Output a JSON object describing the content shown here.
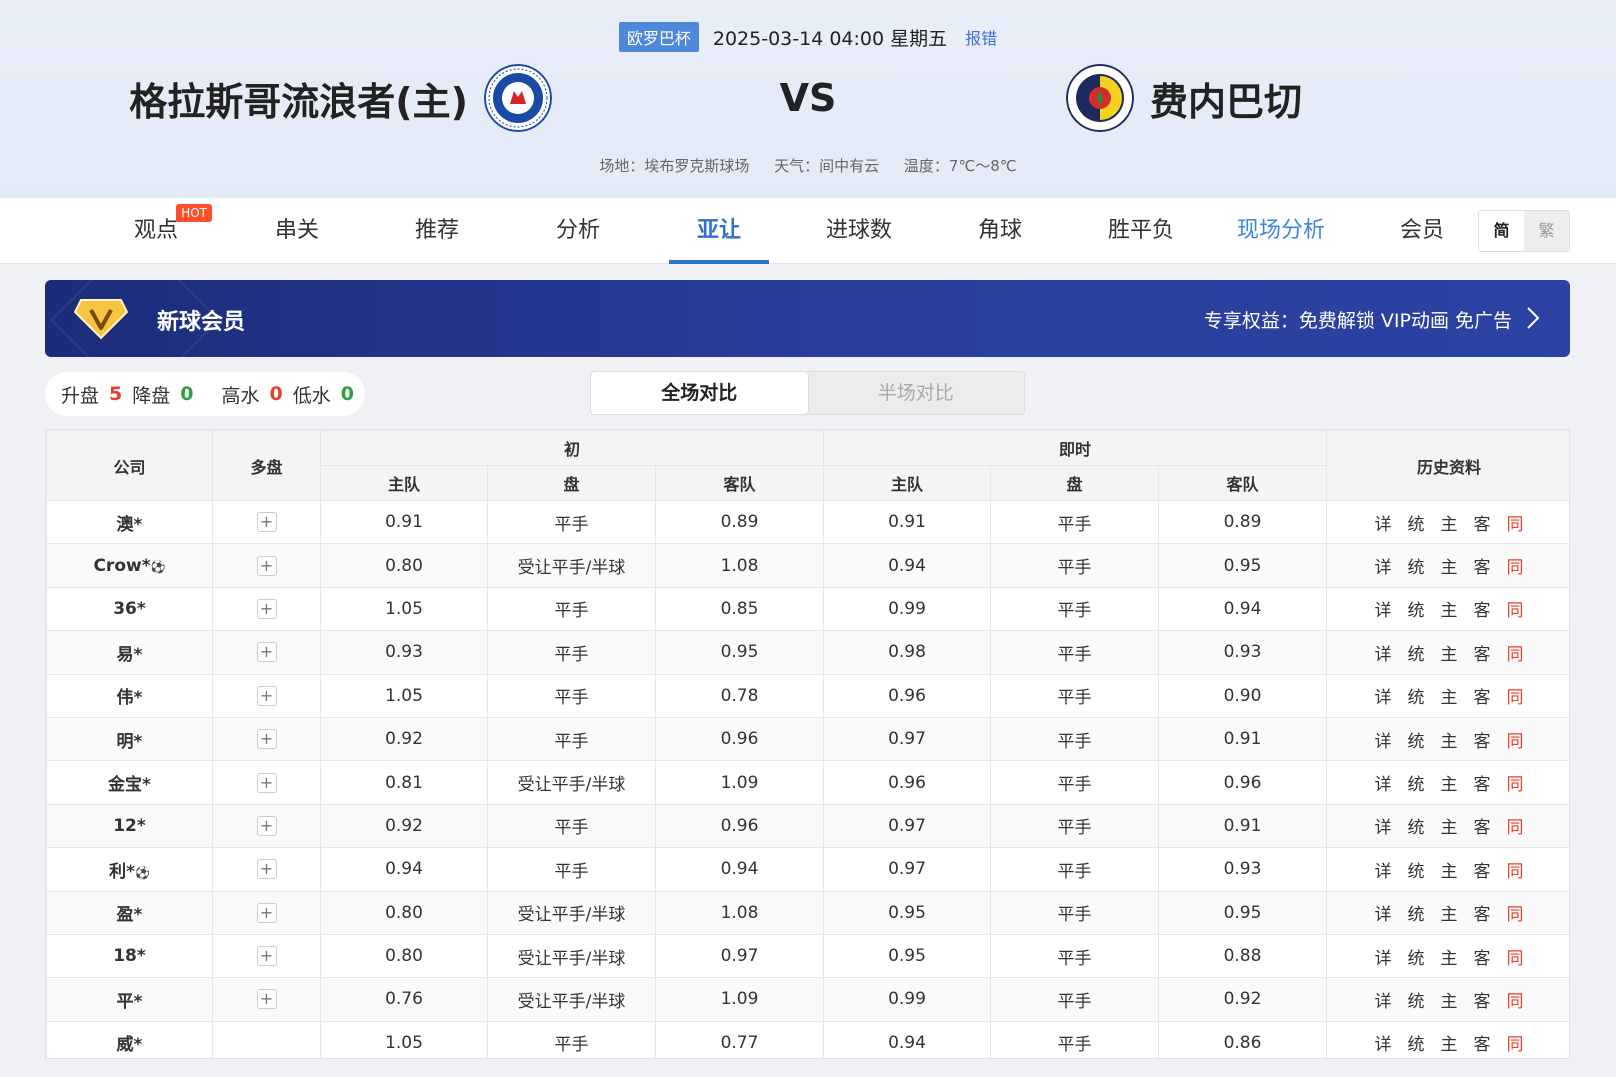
{
  "header": {
    "league": "欧罗巴杯",
    "datetime": "2025-03-14 04:00 星期五",
    "report": "报错",
    "home_team": "格拉斯哥流浪者(主)",
    "vs": "VS",
    "away_team": "费内巴切",
    "venue": "场地：埃布罗克斯球场",
    "weather": "天气：间中有云",
    "temperature": "温度：7℃～8℃"
  },
  "tabs": [
    {
      "label": "观点",
      "badge": "HOT"
    },
    {
      "label": "串关"
    },
    {
      "label": "推荐"
    },
    {
      "label": "分析"
    },
    {
      "label": "亚让"
    },
    {
      "label": "进球数"
    },
    {
      "label": "角球"
    },
    {
      "label": "胜平负"
    },
    {
      "label": "现场分析"
    },
    {
      "label": "会员"
    }
  ],
  "lang": {
    "simp": "简",
    "trad": "繁"
  },
  "vip": {
    "title": "新球会员",
    "benefit": "专享权益：免费解锁 VIP动画 免广告"
  },
  "stats": {
    "up_label": "升盘",
    "up_value": "5",
    "down_label": "降盘",
    "down_value": "0",
    "high_label": "高水",
    "high_value": "0",
    "low_label": "低水",
    "low_value": "0"
  },
  "segment": {
    "full": "全场对比",
    "half": "半场对比"
  },
  "table": {
    "headers": {
      "company": "公司",
      "multi": "多盘",
      "initial": "初",
      "live": "即时",
      "history": "历史资料",
      "home": "主队",
      "handicap": "盘",
      "away": "客队"
    },
    "history_links": {
      "detail": "详",
      "stats": "统",
      "home": "主",
      "away": "客",
      "same": "同"
    },
    "rows": [
      {
        "company": "澳*",
        "ball": "",
        "multi": true,
        "i_home": "0.91",
        "i_hcp": "平手",
        "i_away": "0.89",
        "l_home": "0.91",
        "l_hcp": "平手",
        "l_away": "0.89"
      },
      {
        "company": "Crow*",
        "ball": "⚽",
        "multi": true,
        "i_home": "0.80",
        "i_hcp": "受让平手/半球",
        "i_away": "1.08",
        "l_home": "0.94",
        "l_hcp": "平手",
        "l_away": "0.95"
      },
      {
        "company": "36*",
        "ball": "",
        "multi": true,
        "i_home": "1.05",
        "i_hcp": "平手",
        "i_away": "0.85",
        "l_home": "0.99",
        "l_hcp": "平手",
        "l_away": "0.94"
      },
      {
        "company": "易*",
        "ball": "",
        "multi": true,
        "i_home": "0.93",
        "i_hcp": "平手",
        "i_away": "0.95",
        "l_home": "0.98",
        "l_hcp": "平手",
        "l_away": "0.93"
      },
      {
        "company": "伟*",
        "ball": "",
        "multi": true,
        "i_home": "1.05",
        "i_hcp": "平手",
        "i_away": "0.78",
        "l_home": "0.96",
        "l_hcp": "平手",
        "l_away": "0.90"
      },
      {
        "company": "明*",
        "ball": "",
        "multi": true,
        "i_home": "0.92",
        "i_hcp": "平手",
        "i_away": "0.96",
        "l_home": "0.97",
        "l_hcp": "平手",
        "l_away": "0.91"
      },
      {
        "company": "金宝*",
        "ball": "",
        "multi": true,
        "i_home": "0.81",
        "i_hcp": "受让平手/半球",
        "i_away": "1.09",
        "l_home": "0.96",
        "l_hcp": "平手",
        "l_away": "0.96"
      },
      {
        "company": "12*",
        "ball": "",
        "multi": true,
        "i_home": "0.92",
        "i_hcp": "平手",
        "i_away": "0.96",
        "l_home": "0.97",
        "l_hcp": "平手",
        "l_away": "0.91"
      },
      {
        "company": "利*",
        "ball": "⚽",
        "multi": true,
        "i_home": "0.94",
        "i_hcp": "平手",
        "i_away": "0.94",
        "l_home": "0.97",
        "l_hcp": "平手",
        "l_away": "0.93"
      },
      {
        "company": "盈*",
        "ball": "",
        "multi": true,
        "i_home": "0.80",
        "i_hcp": "受让平手/半球",
        "i_away": "1.08",
        "l_home": "0.95",
        "l_hcp": "平手",
        "l_away": "0.95"
      },
      {
        "company": "18*",
        "ball": "",
        "multi": true,
        "i_home": "0.80",
        "i_hcp": "受让平手/半球",
        "i_away": "0.97",
        "l_home": "0.95",
        "l_hcp": "平手",
        "l_away": "0.88"
      },
      {
        "company": "平*",
        "ball": "",
        "multi": true,
        "i_home": "0.76",
        "i_hcp": "受让平手/半球",
        "i_away": "1.09",
        "l_home": "0.99",
        "l_hcp": "平手",
        "l_away": "0.92"
      },
      {
        "company": "威*",
        "ball": "",
        "multi": false,
        "i_home": "1.05",
        "i_hcp": "平手",
        "i_away": "0.77",
        "l_home": "0.94",
        "l_hcp": "平手",
        "l_away": "0.86"
      }
    ]
  },
  "colors": {
    "accent": "#2f6fd0",
    "red": "#e8402e",
    "green": "#2e9e3e",
    "vip_bg": "#22348c"
  }
}
